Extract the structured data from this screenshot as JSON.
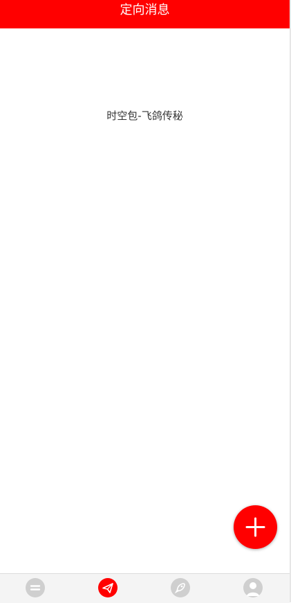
{
  "header": {
    "title": "定向消息"
  },
  "content": {
    "message": "时空包-飞鸽传秘"
  },
  "fab": {
    "icon": "plus-icon"
  },
  "tabbar": {
    "active_color": "#ff0000",
    "inactive_color": "#cccccc",
    "items": [
      {
        "icon": "equals-circle-icon",
        "label": "",
        "active": false
      },
      {
        "icon": "paper-plane-icon",
        "label": "",
        "active": true
      },
      {
        "icon": "rocket-icon",
        "label": "",
        "active": false
      },
      {
        "icon": "user-avatar-icon",
        "label": "",
        "active": false
      }
    ]
  }
}
